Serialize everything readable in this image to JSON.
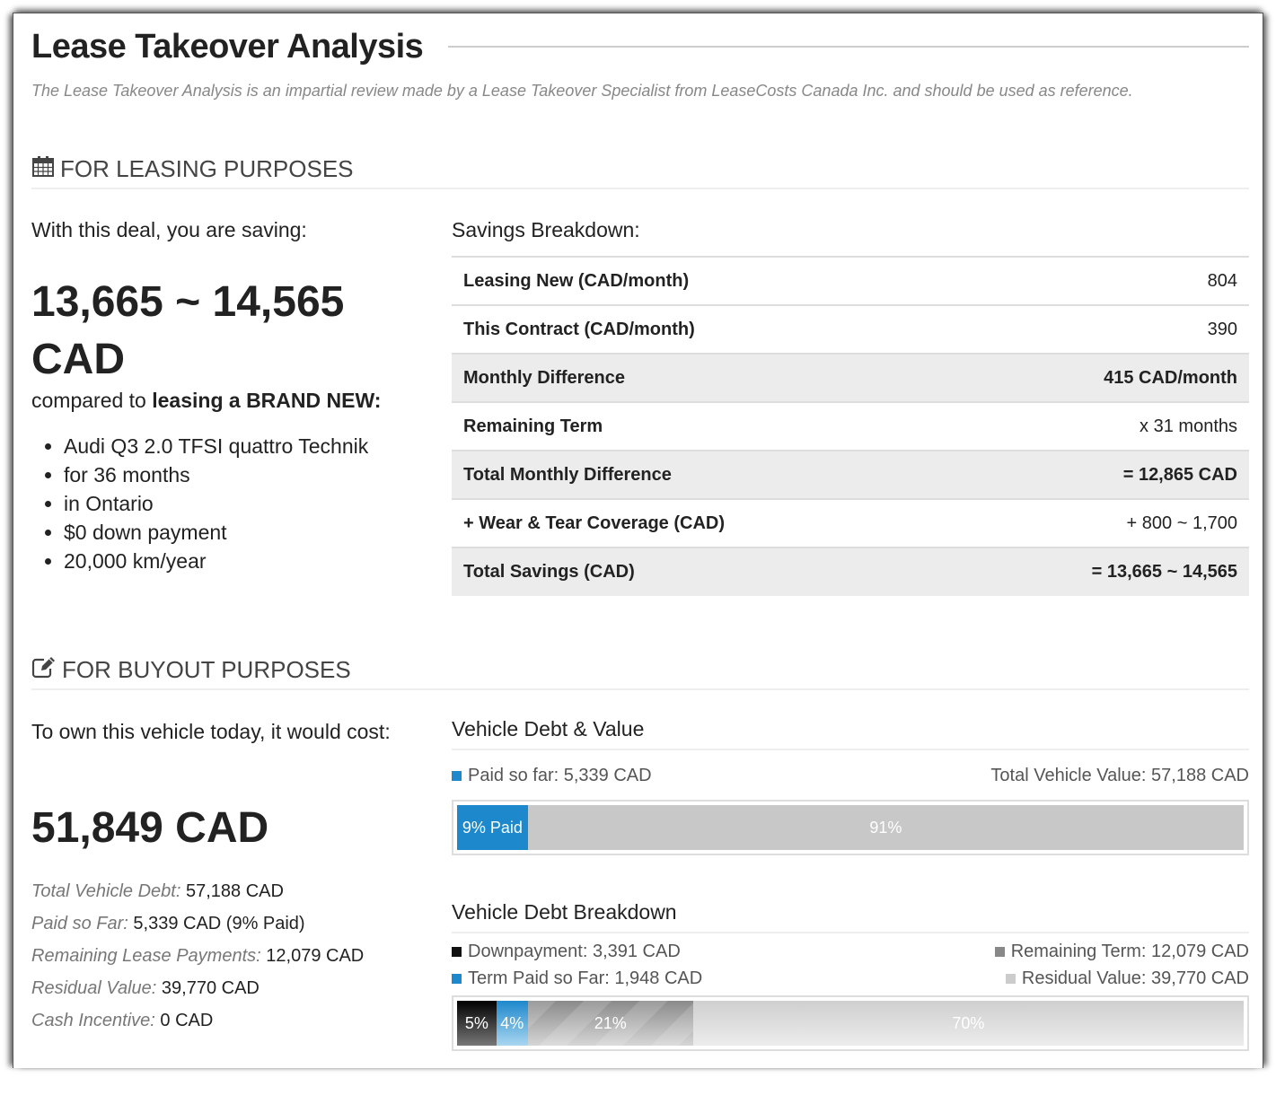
{
  "header": {
    "title": "Lease Takeover Analysis",
    "subtitle": "The Lease Takeover Analysis is an impartial review made by a Lease Takeover Specialist from LeaseCosts Canada Inc. and should be used as reference."
  },
  "leasing": {
    "section_title": "FOR LEASING PURPOSES",
    "section_icon": "calendar-icon",
    "lead": "With this deal, you are saving:",
    "savings_range": "13,665 ~ 14,565",
    "savings_currency": "CAD",
    "compare_prefix": "compared to ",
    "compare_bold": "leasing a BRAND NEW:",
    "specs": [
      "Audi Q3 2.0 TFSI quattro Technik",
      "for 36 months",
      "in Ontario",
      "$0 down payment",
      "20,000 km/year"
    ],
    "breakdown_title": "Savings Breakdown:",
    "breakdown_rows": [
      {
        "label": "Leasing New (CAD/month)",
        "value": "804"
      },
      {
        "label": "This Contract (CAD/month)",
        "value": "390"
      },
      {
        "label": "Monthly Difference",
        "value": "415 CAD/month"
      },
      {
        "label": "Remaining Term",
        "value": "x 31 months"
      },
      {
        "label": "Total Monthly Difference",
        "value": "= 12,865 CAD"
      },
      {
        "label": "+ Wear & Tear Coverage (CAD)",
        "value": "+ 800 ~ 1,700"
      },
      {
        "label": "Total Savings (CAD)",
        "value": "= 13,665 ~ 14,565"
      }
    ]
  },
  "buyout": {
    "section_title": "FOR BUYOUT PURPOSES",
    "section_icon": "edit-icon",
    "lead": "To own this vehicle today, it would cost:",
    "cost": "51,849 CAD",
    "facts": [
      {
        "label": "Total Vehicle Debt:",
        "value": "57,188 CAD"
      },
      {
        "label": "Paid so Far:",
        "value": "5,339 CAD (9% Paid)"
      },
      {
        "label": "Remaining Lease Payments:",
        "value": "12,079 CAD"
      },
      {
        "label": "Residual Value:",
        "value": "39,770 CAD"
      },
      {
        "label": "Cash Incentive:",
        "value": "0 CAD"
      }
    ],
    "debt_value": {
      "title": "Vehicle Debt & Value",
      "legend_left": "Paid so far: 5,339 CAD",
      "legend_right": "Total Vehicle Value: 57,188 CAD",
      "colors": {
        "paid": "#1e88cc",
        "remaining": "#c8c8c8"
      },
      "segments": [
        {
          "label": "9% Paid",
          "percent": 9
        },
        {
          "label": "91%",
          "percent": 91
        }
      ]
    },
    "debt_breakdown": {
      "title": "Vehicle Debt Breakdown",
      "legend": [
        {
          "label": "Downpayment: 3,391 CAD",
          "color": "#111111"
        },
        {
          "label": "Remaining Term: 12,079 CAD",
          "color": "#888888"
        },
        {
          "label": "Term Paid so Far: 1,948 CAD",
          "color": "#1e88cc"
        },
        {
          "label": "Residual Value: 39,770 CAD",
          "color": "#cccccc"
        }
      ],
      "segments": [
        {
          "label": "5%",
          "percent": 5
        },
        {
          "label": "4%",
          "percent": 4
        },
        {
          "label": "21%",
          "percent": 21
        },
        {
          "label": "70%",
          "percent": 70
        }
      ]
    }
  }
}
